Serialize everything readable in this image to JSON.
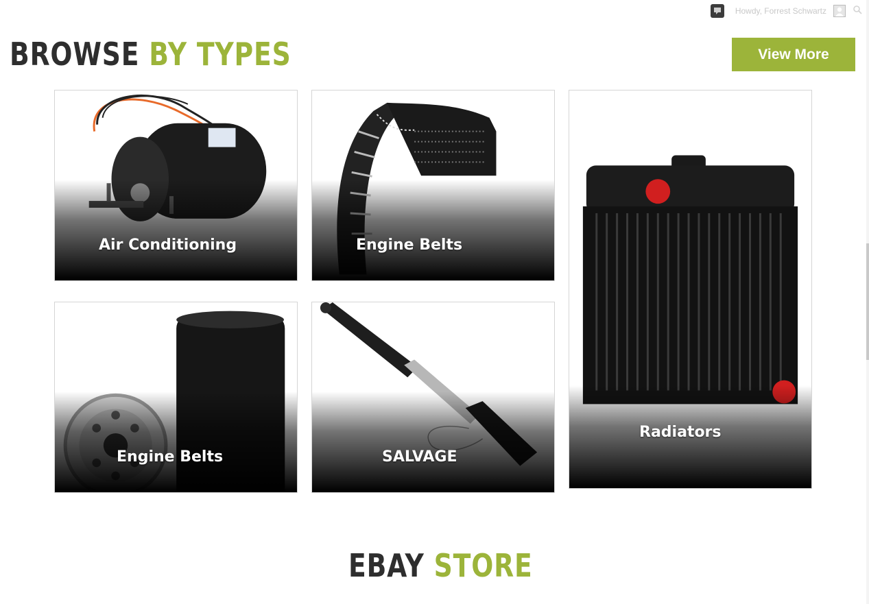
{
  "admin_bar": {
    "greeting": "Howdy, Forrest Schwartz",
    "icons": [
      "comments-icon",
      "avatar",
      "search-icon"
    ]
  },
  "browse_section": {
    "heading_dark": "BROWSE",
    "heading_green": "BY TYPES",
    "view_more_label": "View More",
    "tiles": [
      {
        "label": "Air Conditioning",
        "image": "ac-motor-image"
      },
      {
        "label": "Engine Belts",
        "image": "engine-belt-image"
      },
      {
        "label": "Engine Belts",
        "image": "oil-filter-image"
      },
      {
        "label": "SALVAGE",
        "image": "hydraulic-cylinder-image"
      },
      {
        "label": "Radiators",
        "image": "radiator-image"
      }
    ]
  },
  "store_section": {
    "heading_dark": "EBAY",
    "heading_green": "STORE"
  },
  "colors": {
    "accent_green": "#9cb43a",
    "heading_dark": "#2e2e2e",
    "tile_border": "#d5d5d5"
  }
}
